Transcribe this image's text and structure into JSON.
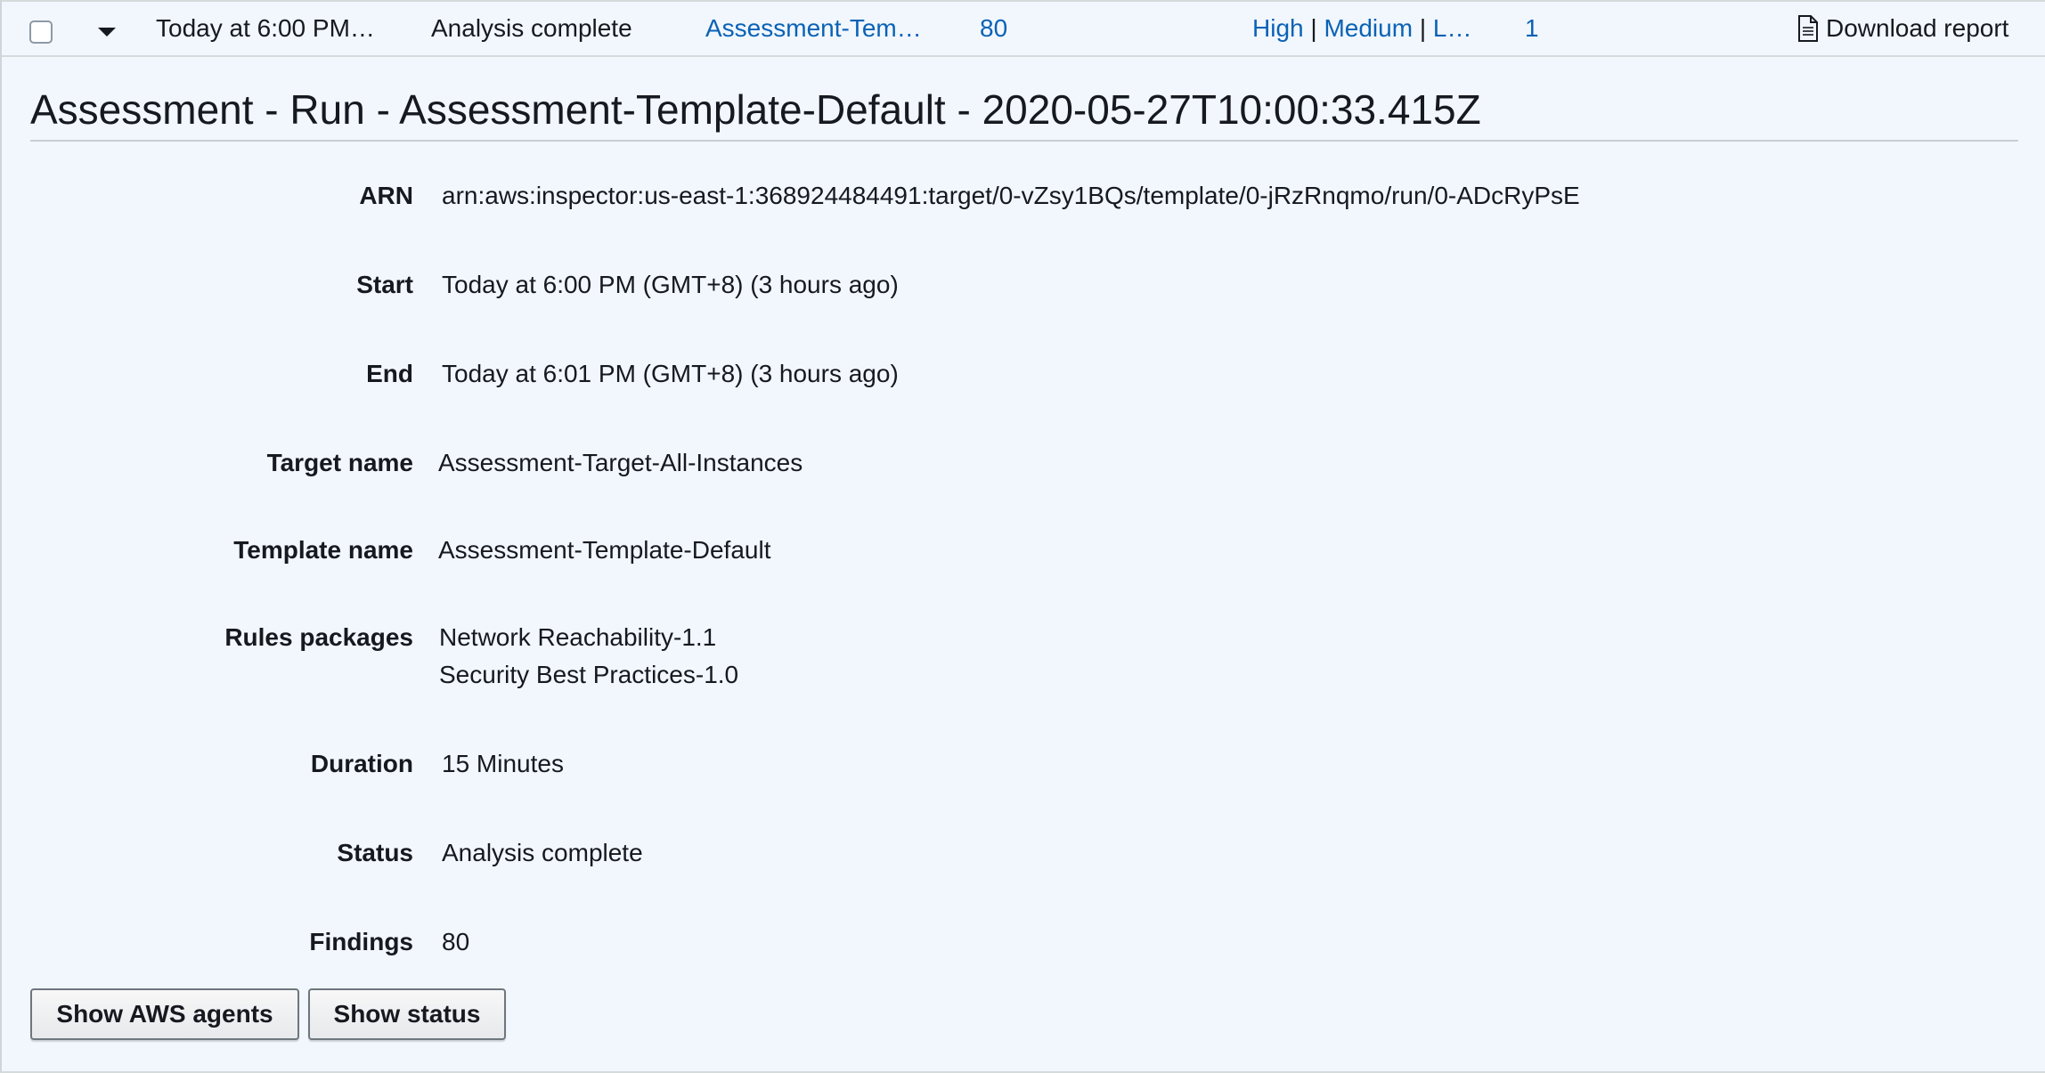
{
  "row": {
    "date": "Today at 6:00 PM…",
    "status": "Analysis complete",
    "template": "Assessment-Tem…",
    "findings": "80",
    "severity": {
      "high": "High",
      "medium": "Medium",
      "low": "L…",
      "separator": "|"
    },
    "count": "1",
    "download_label": "Download report"
  },
  "detail": {
    "title": "Assessment - Run - Assessment-Template-Default - 2020-05-27T10:00:33.415Z",
    "fields": {
      "arn": {
        "label": "ARN",
        "value": "arn:aws:inspector:us-east-1:368924484491:target/0-vZsy1BQs/template/0-jRzRnqmo/run/0-ADcRyPsE"
      },
      "start": {
        "label": "Start",
        "value": "Today at 6:00 PM (GMT+8) (3 hours ago)"
      },
      "end": {
        "label": "End",
        "value": "Today at 6:01 PM (GMT+8) (3 hours ago)"
      },
      "target_name": {
        "label": "Target name",
        "value": "Assessment-Target-All-Instances"
      },
      "template_name": {
        "label": "Template name",
        "value": "Assessment-Template-Default"
      },
      "rules_packages": {
        "label": "Rules packages",
        "values": [
          "Network Reachability-1.1",
          "Security Best Practices-1.0"
        ]
      },
      "duration": {
        "label": "Duration",
        "value": "15 Minutes"
      },
      "status": {
        "label": "Status",
        "value": "Analysis complete"
      },
      "findings": {
        "label": "Findings",
        "value": "80"
      }
    },
    "buttons": {
      "show_agents": "Show AWS agents",
      "show_status": "Show status"
    }
  },
  "colors": {
    "link": "#0b62b5",
    "panel_bg": "#f1f7fd",
    "text": "#16191f"
  },
  "icons": [
    "checkbox",
    "caret-down-icon",
    "document-icon"
  ]
}
